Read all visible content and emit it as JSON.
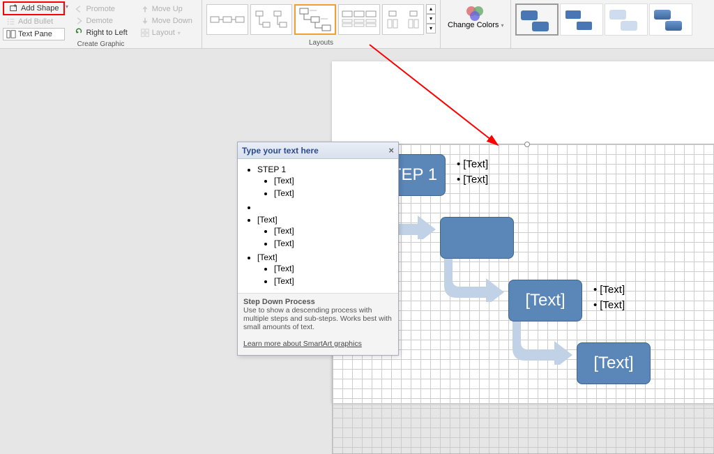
{
  "ribbon": {
    "create_graphic": {
      "label": "Create Graphic",
      "add_shape": "Add Shape",
      "add_bullet": "Add Bullet",
      "text_pane": "Text Pane",
      "promote": "Promote",
      "demote": "Demote",
      "right_to_left": "Right to Left",
      "move_up": "Move Up",
      "move_down": "Move Down",
      "layout": "Layout"
    },
    "layouts": {
      "label": "Layouts"
    },
    "change_colors": "Change\nColors"
  },
  "textpane": {
    "title": "Type your text here",
    "items": [
      {
        "t": "STEP 1",
        "sub": [
          "[Text]",
          "[Text]"
        ]
      },
      {
        "t": "",
        "sub": []
      },
      {
        "t": "[Text]",
        "sub": [
          "[Text]",
          "[Text]"
        ]
      },
      {
        "t": "[Text]",
        "sub": [
          "[Text]",
          "[Text]"
        ]
      }
    ],
    "footer_title": "Step Down Process",
    "footer_desc": "Use to show a descending process with multiple steps and sub-steps. Works best with small amounts of text.",
    "footer_link": "Learn more about SmartArt graphics"
  },
  "smartart": {
    "steps": [
      {
        "label": "STEP 1",
        "subs": [
          "[Text]",
          "[Text]"
        ]
      },
      {
        "label": "",
        "subs": []
      },
      {
        "label": "[Text]",
        "subs": [
          "[Text]",
          "[Text]"
        ]
      },
      {
        "label": "[Text]",
        "subs": []
      }
    ]
  }
}
